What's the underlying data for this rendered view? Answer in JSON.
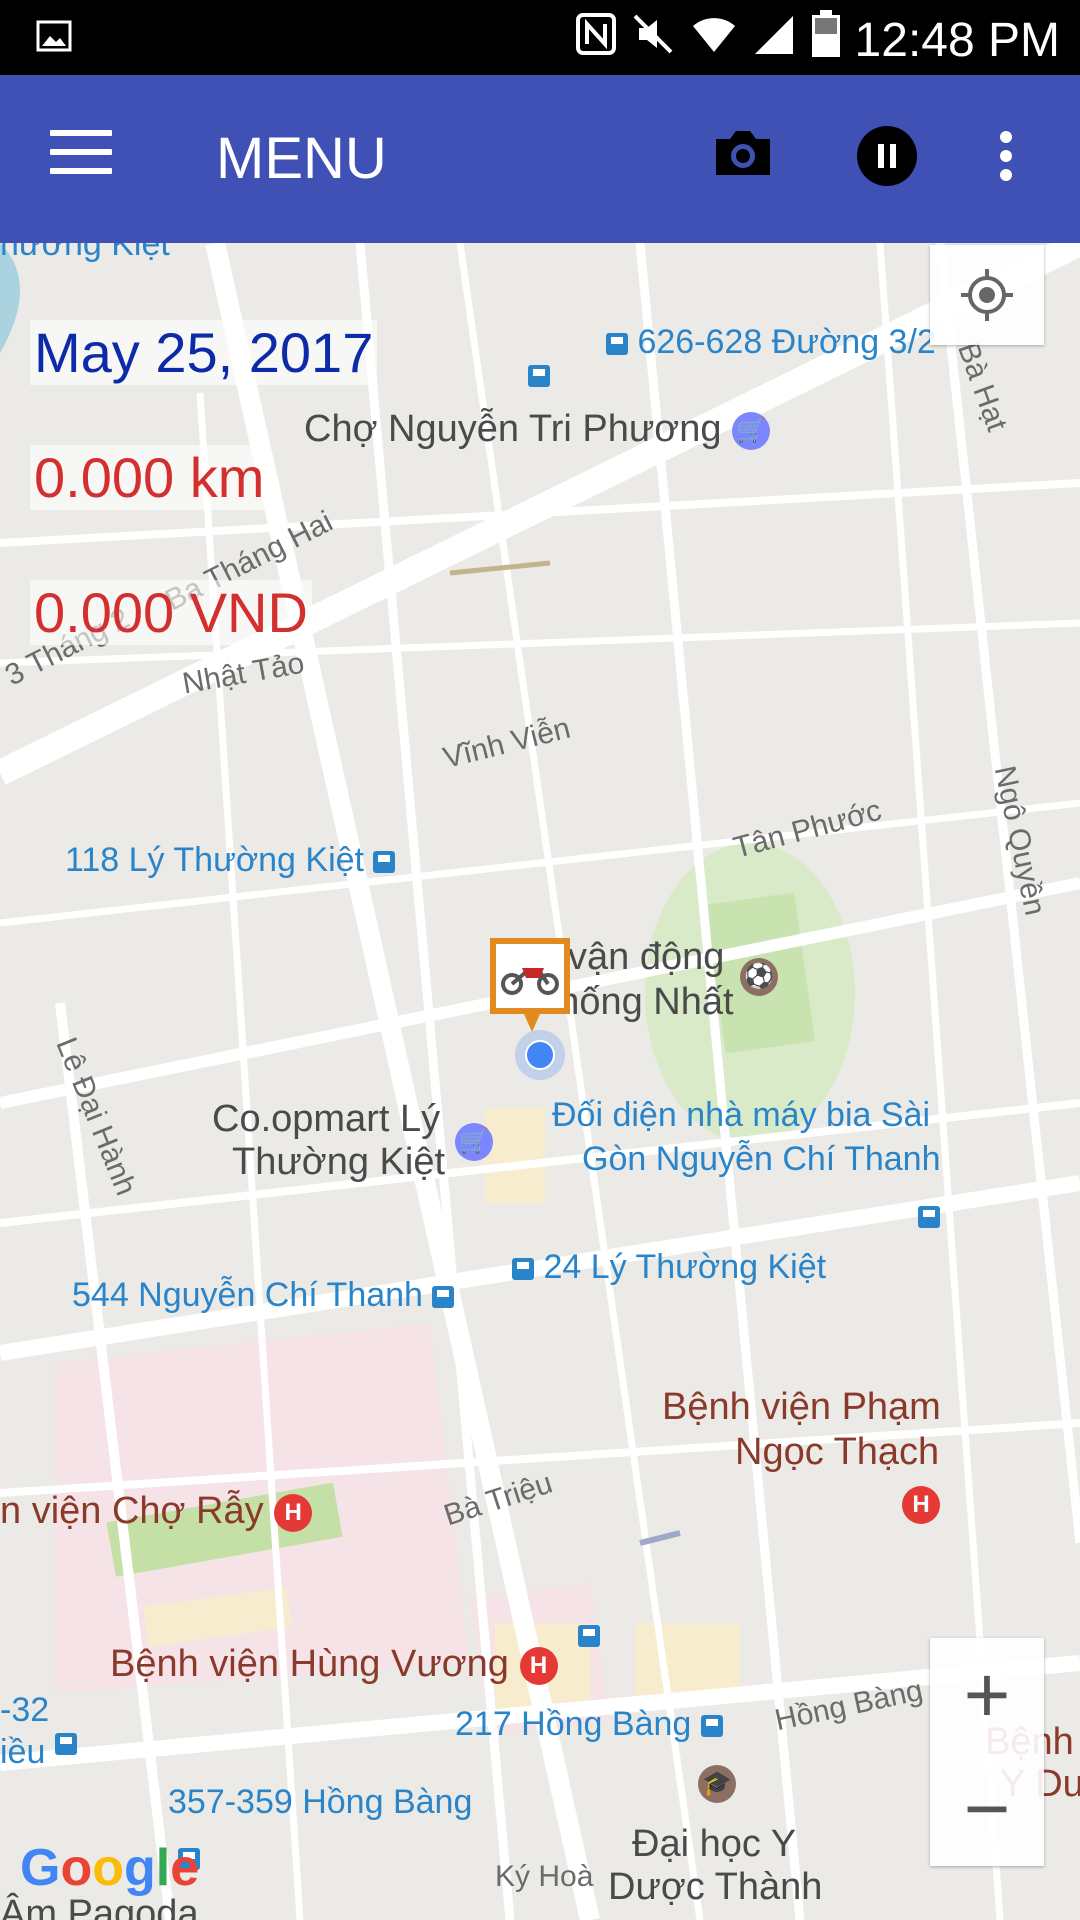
{
  "status_bar": {
    "time": "12:48 PM",
    "icons": [
      "image-icon",
      "nfc-icon",
      "mute-icon",
      "wifi-icon",
      "signal-icon",
      "battery-icon"
    ]
  },
  "app_bar": {
    "title": "MENU",
    "icons": [
      "hamburger-menu-icon",
      "camera-icon",
      "pause-icon",
      "more-vert-icon"
    ]
  },
  "overlay": {
    "date": "May 25, 2017",
    "distance": "0.000 km",
    "fare": "0.000 VND"
  },
  "map": {
    "labels": {
      "l1": "626-628 Đường 3/2",
      "l2": "Chợ Nguyễn Tri Phương",
      "l3": "Bà Hạt",
      "l4": "3 Tháng 2",
      "l5": "Ba Tháng Hai",
      "l6": "Nhật Tảo",
      "l7": "Vĩnh Viễn",
      "l8": "Tân Phước",
      "l9": "Ngô Quyền",
      "l10": "118 Lý Thường Kiệt",
      "l11": "vận động",
      "l12": "Thống Nhất",
      "l13": "Lê Đại Hành",
      "l14": "Co.opmart Lý",
      "l15": "Thường Kiệt",
      "l16": "Đối diện nhà máy bia Sài",
      "l17": "Gòn Nguyễn Chí Thanh",
      "l18": "24 Lý Thường Kiệt",
      "l19": "544 Nguyễn Chí Thanh",
      "l20": "Bệnh viện Phạm",
      "l21": "Ngọc Thạch",
      "l22": "n viện Chợ Rẫy",
      "l23": "Bà Triệu",
      "l24": "Bệnh viện Hùng Vương",
      "l25": "217 Hồng Bàng",
      "l26": "Hồng Bàng",
      "l27": "357-359 Hồng Bàng",
      "l28": "Đại học Y",
      "l29": "Dược Thành",
      "l30": "Ký Hoà",
      "l31": "Âm Pagoda",
      "l32": "hương Kiệt",
      "l33": "Bệnh",
      "l34": "Y Dư",
      "l35": "-32",
      "l36": "iều"
    },
    "poi_h": "H",
    "logo": "Google"
  },
  "controls": {
    "zoom_in": "+",
    "zoom_out": "−"
  }
}
